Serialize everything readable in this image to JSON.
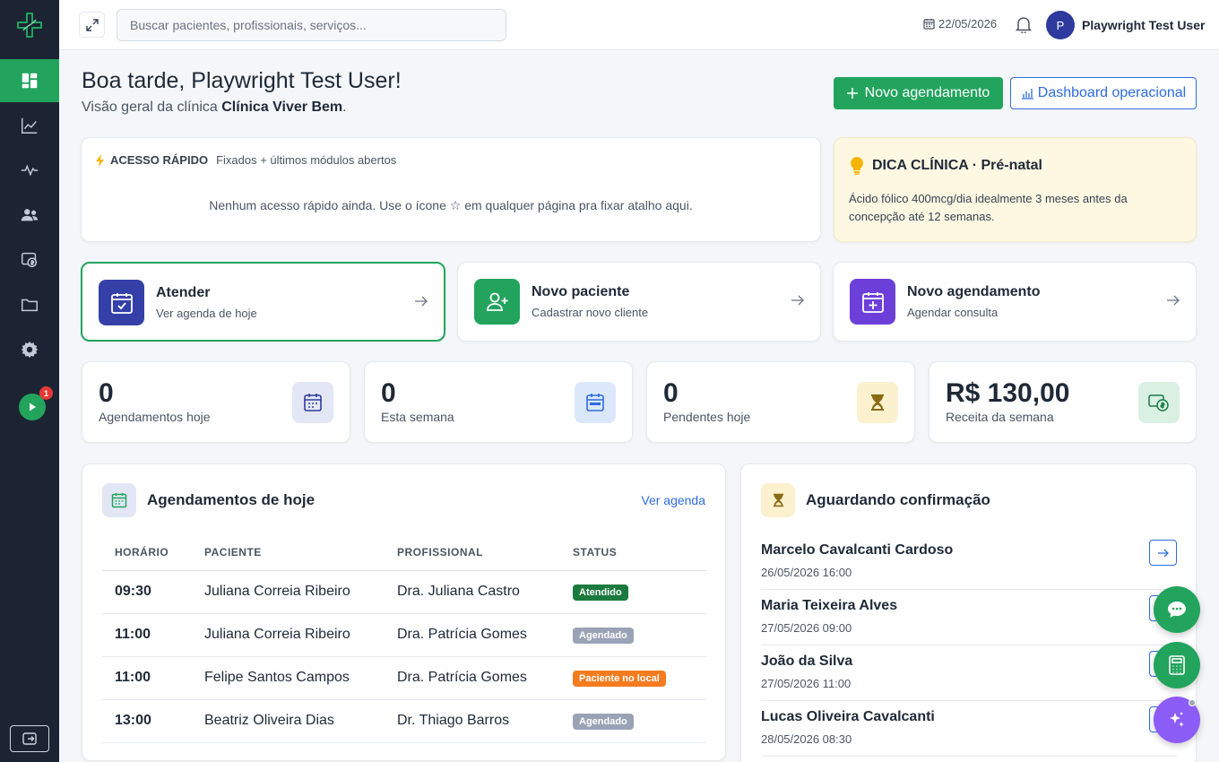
{
  "colors": {
    "sidebar": "#1c2434",
    "accent_green": "#22a45d",
    "accent_blue": "#2d6cdf",
    "tip_bg": "#fef8e3"
  },
  "sidebar": {
    "items": [
      {
        "icon": "dashboard-icon",
        "active": true
      },
      {
        "icon": "line-chart-icon"
      },
      {
        "icon": "activity-icon"
      },
      {
        "icon": "users-icon"
      },
      {
        "icon": "finance-icon"
      },
      {
        "icon": "folder-icon"
      },
      {
        "icon": "gear-icon"
      }
    ],
    "play_badge": "1"
  },
  "topbar": {
    "search_placeholder": "Buscar pacientes, profissionais, serviços...",
    "date": "22/05/2026",
    "avatar_initial": "P",
    "user_name": "Playwright Test User"
  },
  "header": {
    "greeting": "Boa tarde, Playwright Test User!",
    "subtitle_prefix": "Visão geral da clínica ",
    "clinic_name": "Clínica Viver Bem",
    "subtitle_suffix": ".",
    "new_appointment_label": "Novo agendamento",
    "dashboard_label": "Dashboard operacional"
  },
  "quick_access": {
    "title": "ACESSO RÁPIDO",
    "subtitle": "Fixados + últimos módulos abertos",
    "empty_before": "Nenhum acesso rápido ainda. Use o ícone ",
    "empty_after": " em qualquer página pra fixar atalho aqui."
  },
  "tip": {
    "title": "DICA CLÍNICA · Pré-natal",
    "text": "Ácido fólico 400mcg/dia idealmente 3 meses antes da concepção até 12 semanas."
  },
  "actions": [
    {
      "title": "Atender",
      "subtitle": "Ver agenda de hoje",
      "color": "#3440a8"
    },
    {
      "title": "Novo paciente",
      "subtitle": "Cadastrar novo cliente",
      "color": "#22a45d"
    },
    {
      "title": "Novo agendamento",
      "subtitle": "Agendar consulta",
      "color": "#6d3fd9"
    }
  ],
  "stats": [
    {
      "value": "0",
      "label": "Agendamentos hoje",
      "bg": "#e3e7f5",
      "fg": "#2f3a9e"
    },
    {
      "value": "0",
      "label": "Esta semana",
      "bg": "#dbe8fb",
      "fg": "#2d6cdf"
    },
    {
      "value": "0",
      "label": "Pendentes hoje",
      "bg": "#fcf1cf",
      "fg": "#8a6a12"
    },
    {
      "value": "R$ 130,00",
      "label": "Receita da semana",
      "bg": "#d9f0e3",
      "fg": "#1b7a45"
    }
  ],
  "today": {
    "title": "Agendamentos de hoje",
    "link": "Ver agenda",
    "columns": [
      "HORÁRIO",
      "PACIENTE",
      "PROFISSIONAL",
      "STATUS"
    ],
    "rows": [
      {
        "time": "09:30",
        "patient": "Juliana Correia Ribeiro",
        "professional": "Dra. Juliana Castro",
        "status": "Atendido",
        "status_color": "#1b7a3e"
      },
      {
        "time": "11:00",
        "patient": "Juliana Correia Ribeiro",
        "professional": "Dra. Patrícia Gomes",
        "status": "Agendado",
        "status_color": "#9aa3b5"
      },
      {
        "time": "11:00",
        "patient": "Felipe Santos Campos",
        "professional": "Dra. Patrícia Gomes",
        "status": "Paciente no local",
        "status_color": "#f47c1f"
      },
      {
        "time": "13:00",
        "patient": "Beatriz Oliveira Dias",
        "professional": "Dr. Thiago Barros",
        "status": "Agendado",
        "status_color": "#9aa3b5"
      }
    ]
  },
  "pending": {
    "title": "Aguardando confirmação",
    "items": [
      {
        "name": "Marcelo Cavalcanti Cardoso",
        "date": "26/05/2026 16:00"
      },
      {
        "name": "Maria Teixeira Alves",
        "date": "27/05/2026 09:00"
      },
      {
        "name": "João da Silva",
        "date": "27/05/2026 11:00"
      },
      {
        "name": "Lucas Oliveira Cavalcanti",
        "date": "28/05/2026 08:30"
      }
    ]
  }
}
